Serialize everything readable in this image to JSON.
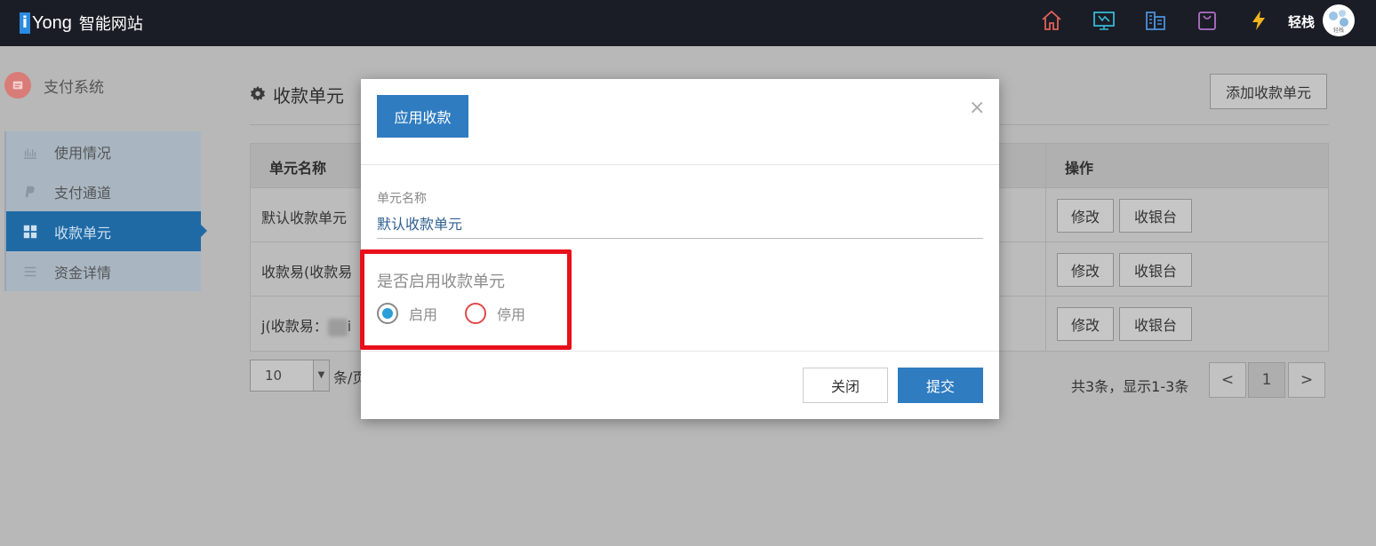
{
  "header": {
    "logo_letter": "i",
    "logo_text": "Yong",
    "logo_cn": "智能网站",
    "username": "轻栈",
    "icons": [
      "home-icon",
      "monitor-icon",
      "building-icon",
      "bag-icon",
      "lightning-icon"
    ],
    "avatar_text": "轻栈"
  },
  "sidebar": {
    "system_title": "支付系统",
    "items": [
      {
        "label": "使用情况",
        "icon": "bar-chart-icon",
        "active": false
      },
      {
        "label": "支付通道",
        "icon": "paypal-icon",
        "active": false
      },
      {
        "label": "收款单元",
        "icon": "grid-icon",
        "active": true
      },
      {
        "label": "资金详情",
        "icon": "list-icon",
        "active": false
      }
    ]
  },
  "main": {
    "title": "收款单元",
    "add_button": "添加收款单元",
    "table": {
      "headers": {
        "name": "单元名称",
        "ops": "操作"
      },
      "rows": [
        {
          "name": "默认收款单元",
          "edit": "修改",
          "pos": "收银台"
        },
        {
          "name": "收款易(收款易",
          "edit": "修改",
          "pos": "收银台"
        },
        {
          "name_prefix": "j(收款易：",
          "name_suffix": "i",
          "edit": "修改",
          "pos": "收银台"
        }
      ]
    },
    "pager": {
      "page_size": "10",
      "unit": "条/页",
      "summary": "共3条，显示1-3条",
      "prev": "<",
      "current": "1",
      "next": ">"
    }
  },
  "modal": {
    "tab": "应用收款",
    "close_symbol": "×",
    "field_label": "单元名称",
    "field_value": "默认收款单元",
    "enable_label": "是否启用收款单元",
    "radio_on": "启用",
    "radio_off": "停用",
    "btn_close": "关闭",
    "btn_submit": "提交"
  },
  "colors": {
    "topbar": "#1a1d25",
    "accent": "#2f7cc0",
    "highlight": "#e8101b",
    "radio_selected": "#2a9fd8"
  }
}
